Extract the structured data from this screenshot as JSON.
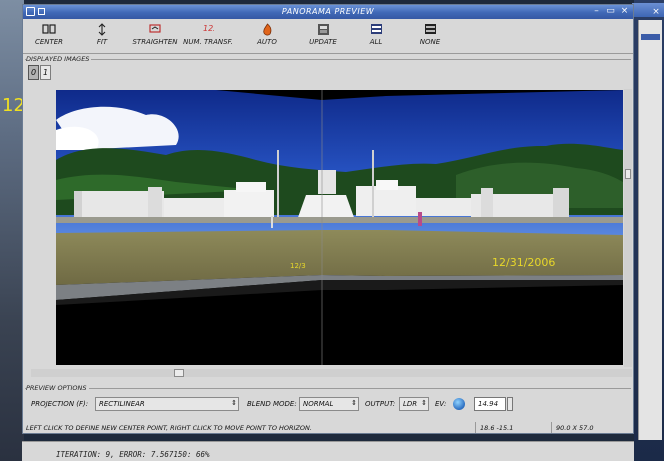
{
  "background": {
    "left_overlay_text": "12",
    "status_text": "ITERATION: 9, ERROR: 7.567150: 66%"
  },
  "window": {
    "title": "PANORAMA PREVIEW",
    "accent_color": "#4068b6"
  },
  "toolbar": {
    "items": [
      {
        "label": "CENTER",
        "icon": "center-icon"
      },
      {
        "label": "FIT",
        "icon": "fit-icon"
      },
      {
        "label": "STRAIGHTEN",
        "icon": "straighten-icon"
      },
      {
        "label": "NUM. TRANSF.",
        "icon": "num-transf-icon"
      },
      {
        "label": "AUTO",
        "icon": "auto-icon"
      },
      {
        "label": "UPDATE",
        "icon": "update-icon"
      },
      {
        "label": "ALL",
        "icon": "all-icon"
      },
      {
        "label": "NONE",
        "icon": "none-icon"
      }
    ]
  },
  "displayed_images": {
    "label": "DISPLAYED IMAGES",
    "buttons": [
      "0",
      "1"
    ]
  },
  "preview": {
    "date_right": "12/31/2006",
    "date_left": "12/3"
  },
  "preview_options": {
    "label": "PREVIEW OPTIONS",
    "projection_label": "PROJECTION (F):",
    "projection_value": "RECTILINEAR",
    "blend_label": "BLEND MODE:",
    "blend_value": "NORMAL",
    "output_label": "OUTPUT:",
    "output_value": "LDR",
    "ev_label": "EV:",
    "ev_value": "14.94"
  },
  "status": {
    "message": "LEFT CLICK TO DEFINE NEW CENTER POINT, RIGHT CLICK TO MOVE POINT TO HORIZON.",
    "coords": "18.6 -15.1",
    "fov": "90.0 X 57.0"
  }
}
